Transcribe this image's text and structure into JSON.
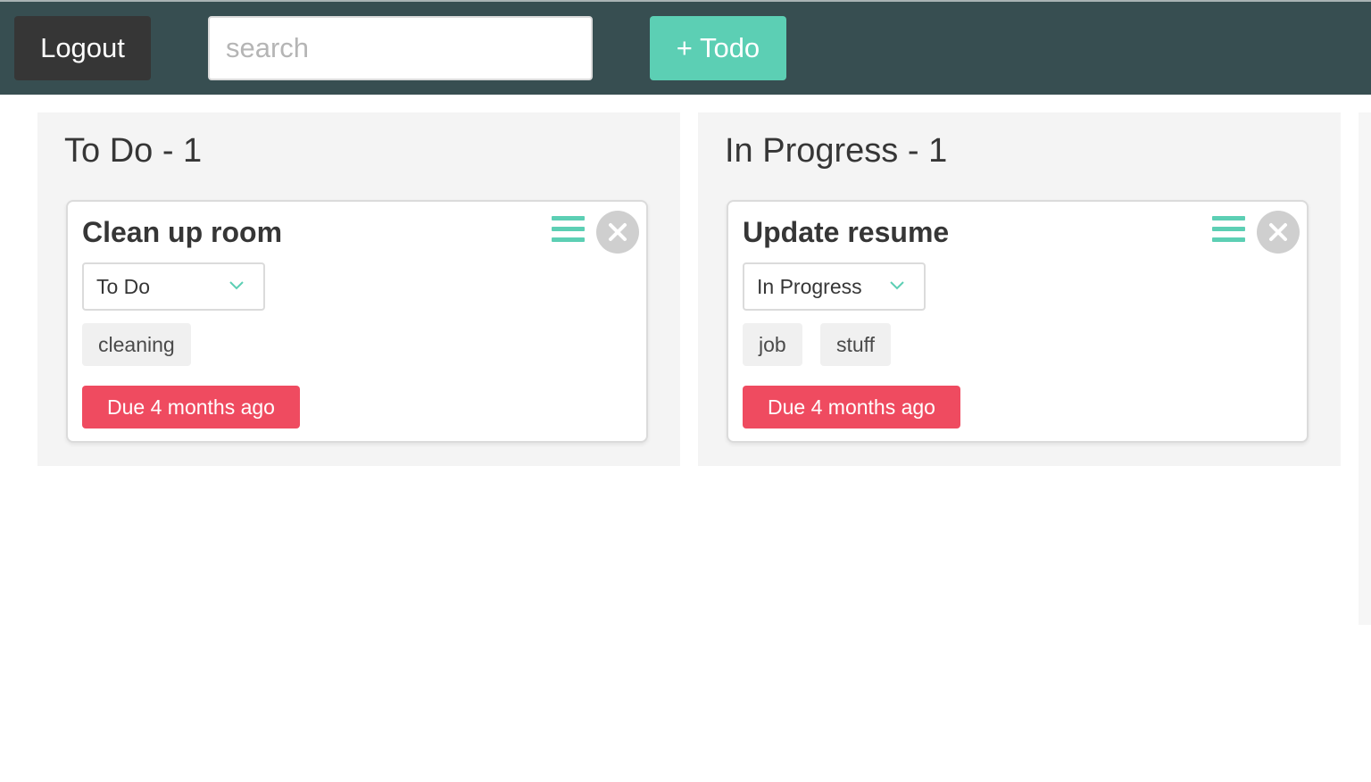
{
  "header": {
    "logout_label": "Logout",
    "search_placeholder": "search",
    "search_value": "",
    "add_todo_label": "+ Todo"
  },
  "colors": {
    "header_bg": "#374e51",
    "accent": "#5ccfb4",
    "due_badge": "#ef4b60",
    "logout_bg": "#363636",
    "column_bg": "#f4f4f4"
  },
  "columns": [
    {
      "title": "To Do - 1",
      "cards": [
        {
          "title": "Clean up room",
          "status": "To Do",
          "tags": [
            "cleaning"
          ],
          "due": "Due 4 months ago",
          "icons": [
            "menu-icon",
            "close-icon",
            "chevron-down-icon"
          ]
        }
      ]
    },
    {
      "title": "In Progress - 1",
      "cards": [
        {
          "title": "Update resume",
          "status": "In Progress",
          "tags": [
            "job",
            "stuff"
          ],
          "due": "Due 4 months ago",
          "icons": [
            "menu-icon",
            "close-icon",
            "chevron-down-icon"
          ]
        }
      ]
    }
  ]
}
